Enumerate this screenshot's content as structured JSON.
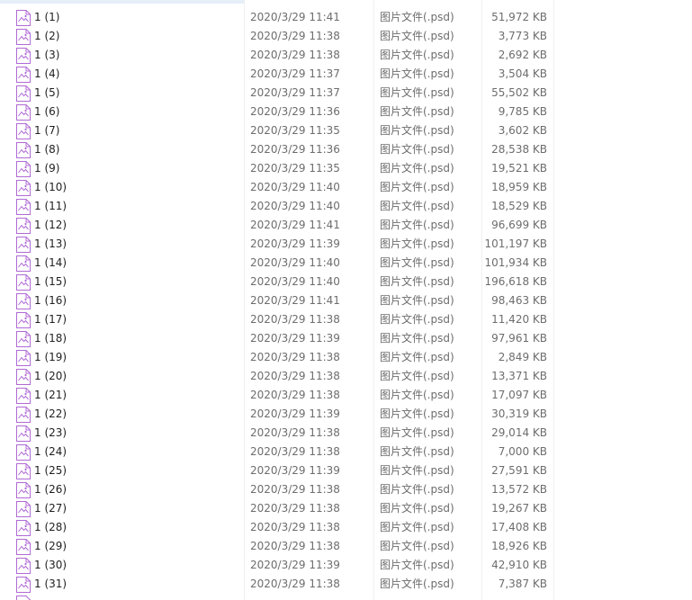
{
  "colors": {
    "icon_accent": "#b06ad6",
    "text_primary": "#1f1f1f",
    "text_secondary": "#6d6d6d"
  },
  "files": [
    {
      "name": "1 (1)",
      "modified": "2020/3/29 11:41",
      "type": "图片文件(.psd)",
      "size": "51,972 KB",
      "icon": "image-file-icon"
    },
    {
      "name": "1 (2)",
      "modified": "2020/3/29 11:38",
      "type": "图片文件(.psd)",
      "size": "3,773 KB",
      "icon": "image-file-icon"
    },
    {
      "name": "1 (3)",
      "modified": "2020/3/29 11:38",
      "type": "图片文件(.psd)",
      "size": "2,692 KB",
      "icon": "image-file-icon"
    },
    {
      "name": "1 (4)",
      "modified": "2020/3/29 11:37",
      "type": "图片文件(.psd)",
      "size": "3,504 KB",
      "icon": "image-file-icon"
    },
    {
      "name": "1 (5)",
      "modified": "2020/3/29 11:37",
      "type": "图片文件(.psd)",
      "size": "55,502 KB",
      "icon": "image-file-icon"
    },
    {
      "name": "1 (6)",
      "modified": "2020/3/29 11:36",
      "type": "图片文件(.psd)",
      "size": "9,785 KB",
      "icon": "image-file-icon"
    },
    {
      "name": "1 (7)",
      "modified": "2020/3/29 11:35",
      "type": "图片文件(.psd)",
      "size": "3,602 KB",
      "icon": "image-file-icon"
    },
    {
      "name": "1 (8)",
      "modified": "2020/3/29 11:36",
      "type": "图片文件(.psd)",
      "size": "28,538 KB",
      "icon": "image-file-icon"
    },
    {
      "name": "1 (9)",
      "modified": "2020/3/29 11:35",
      "type": "图片文件(.psd)",
      "size": "19,521 KB",
      "icon": "image-file-icon"
    },
    {
      "name": "1 (10)",
      "modified": "2020/3/29 11:40",
      "type": "图片文件(.psd)",
      "size": "18,959 KB",
      "icon": "image-file-icon"
    },
    {
      "name": "1 (11)",
      "modified": "2020/3/29 11:40",
      "type": "图片文件(.psd)",
      "size": "18,529 KB",
      "icon": "image-file-icon"
    },
    {
      "name": "1 (12)",
      "modified": "2020/3/29 11:41",
      "type": "图片文件(.psd)",
      "size": "96,699 KB",
      "icon": "image-file-icon"
    },
    {
      "name": "1 (13)",
      "modified": "2020/3/29 11:39",
      "type": "图片文件(.psd)",
      "size": "101,197 KB",
      "icon": "image-file-icon"
    },
    {
      "name": "1 (14)",
      "modified": "2020/3/29 11:40",
      "type": "图片文件(.psd)",
      "size": "101,934 KB",
      "icon": "image-file-icon"
    },
    {
      "name": "1 (15)",
      "modified": "2020/3/29 11:40",
      "type": "图片文件(.psd)",
      "size": "196,618 KB",
      "icon": "image-file-icon"
    },
    {
      "name": "1 (16)",
      "modified": "2020/3/29 11:41",
      "type": "图片文件(.psd)",
      "size": "98,463 KB",
      "icon": "image-file-icon"
    },
    {
      "name": "1 (17)",
      "modified": "2020/3/29 11:38",
      "type": "图片文件(.psd)",
      "size": "11,420 KB",
      "icon": "image-file-icon"
    },
    {
      "name": "1 (18)",
      "modified": "2020/3/29 11:39",
      "type": "图片文件(.psd)",
      "size": "97,961 KB",
      "icon": "image-file-icon"
    },
    {
      "name": "1 (19)",
      "modified": "2020/3/29 11:38",
      "type": "图片文件(.psd)",
      "size": "2,849 KB",
      "icon": "image-file-icon"
    },
    {
      "name": "1 (20)",
      "modified": "2020/3/29 11:38",
      "type": "图片文件(.psd)",
      "size": "13,371 KB",
      "icon": "image-file-icon"
    },
    {
      "name": "1 (21)",
      "modified": "2020/3/29 11:38",
      "type": "图片文件(.psd)",
      "size": "17,097 KB",
      "icon": "image-file-icon"
    },
    {
      "name": "1 (22)",
      "modified": "2020/3/29 11:39",
      "type": "图片文件(.psd)",
      "size": "30,319 KB",
      "icon": "image-file-icon"
    },
    {
      "name": "1 (23)",
      "modified": "2020/3/29 11:38",
      "type": "图片文件(.psd)",
      "size": "29,014 KB",
      "icon": "image-file-icon"
    },
    {
      "name": "1 (24)",
      "modified": "2020/3/29 11:38",
      "type": "图片文件(.psd)",
      "size": "7,000 KB",
      "icon": "image-file-icon"
    },
    {
      "name": "1 (25)",
      "modified": "2020/3/29 11:39",
      "type": "图片文件(.psd)",
      "size": "27,591 KB",
      "icon": "image-file-icon"
    },
    {
      "name": "1 (26)",
      "modified": "2020/3/29 11:38",
      "type": "图片文件(.psd)",
      "size": "13,572 KB",
      "icon": "image-file-icon"
    },
    {
      "name": "1 (27)",
      "modified": "2020/3/29 11:38",
      "type": "图片文件(.psd)",
      "size": "19,267 KB",
      "icon": "image-file-icon"
    },
    {
      "name": "1 (28)",
      "modified": "2020/3/29 11:38",
      "type": "图片文件(.psd)",
      "size": "17,408 KB",
      "icon": "image-file-icon"
    },
    {
      "name": "1 (29)",
      "modified": "2020/3/29 11:38",
      "type": "图片文件(.psd)",
      "size": "18,926 KB",
      "icon": "image-file-icon"
    },
    {
      "name": "1 (30)",
      "modified": "2020/3/29 11:39",
      "type": "图片文件(.psd)",
      "size": "42,910 KB",
      "icon": "image-file-icon"
    },
    {
      "name": "1 (31)",
      "modified": "2020/3/29 11:38",
      "type": "图片文件(.psd)",
      "size": "7,387 KB",
      "icon": "image-file-icon"
    }
  ]
}
